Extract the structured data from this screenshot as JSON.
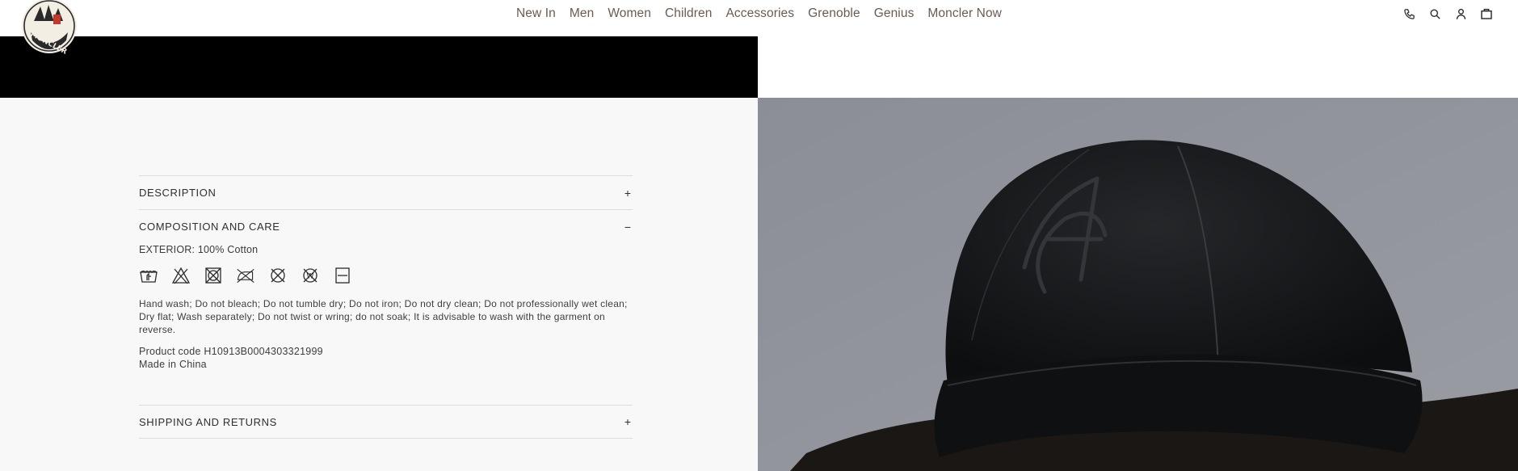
{
  "brand": {
    "logo_text": "MONCLER"
  },
  "nav": {
    "items": [
      {
        "label": "New In"
      },
      {
        "label": "Men"
      },
      {
        "label": "Women"
      },
      {
        "label": "Children"
      },
      {
        "label": "Accessories"
      },
      {
        "label": "Grenoble"
      },
      {
        "label": "Genius"
      },
      {
        "label": "Moncler Now"
      }
    ]
  },
  "header_icons": [
    "phone-icon",
    "search-icon",
    "account-icon",
    "bag-icon"
  ],
  "accordion": {
    "description": {
      "title": "DESCRIPTION",
      "toggle": "+"
    },
    "composition": {
      "title": "COMPOSITION AND CARE",
      "toggle": "−",
      "composition_line": "EXTERIOR: 100% Cotton",
      "care_icons": [
        "hand-wash-icon",
        "do-not-bleach-icon",
        "do-not-tumble-dry-icon",
        "do-not-iron-icon",
        "do-not-dry-clean-icon",
        "do-not-wet-clean-icon",
        "dry-flat-icon"
      ],
      "care_text": "Hand wash; Do not bleach; Do not tumble dry; Do not iron; Do not dry clean; Do not professionally wet clean; Dry flat; Wash separately; Do not twist or wring; do not soak; It is advisable to wash with the garment on reverse.",
      "product_code": "Product code H10913B0004303321999",
      "made_in": "Made in China"
    },
    "shipping": {
      "title": "SHIPPING AND RETURNS",
      "toggle": "+"
    }
  },
  "colors": {
    "nav_text": "#6a5a52",
    "panel_bg": "#f8f8f8",
    "photo_bg": "#8e9098"
  }
}
